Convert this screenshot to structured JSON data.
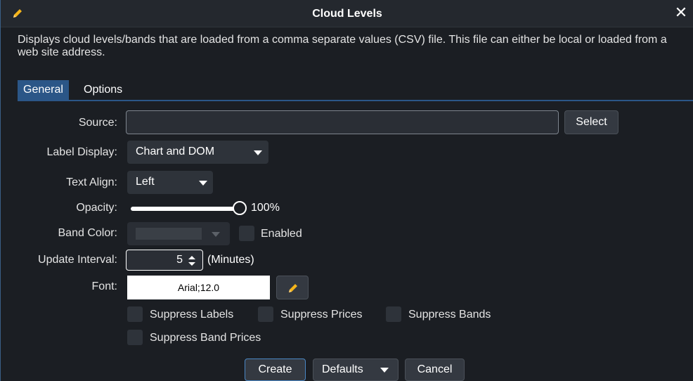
{
  "window": {
    "title": "Cloud Levels",
    "title_icon": "pencil-icon",
    "close_icon": "close-icon",
    "close_glyph": "✕"
  },
  "description": "Displays cloud levels/bands that are loaded from a comma separate values (CSV) file.  This file can either be local or loaded from a web site address.",
  "tabs": [
    {
      "label": "General",
      "active": true
    },
    {
      "label": "Options",
      "active": false
    }
  ],
  "form": {
    "source": {
      "label": "Source:",
      "value": "",
      "button": "Select"
    },
    "label_display": {
      "label": "Label Display:",
      "value": "Chart and DOM"
    },
    "text_align": {
      "label": "Text Align:",
      "value": "Left"
    },
    "opacity": {
      "label": "Opacity:",
      "value_text": "100%",
      "value": 1.0
    },
    "band_color": {
      "label": "Band Color:",
      "enabled_label": "Enabled",
      "enabled": false
    },
    "update_interval": {
      "label": "Update Interval:",
      "value": "5",
      "unit": "(Minutes)"
    },
    "font": {
      "label": "Font:",
      "value": "Arial;12.0",
      "edit_icon": "pencil-icon"
    }
  },
  "checkboxes": [
    {
      "label": "Suppress Labels",
      "checked": false
    },
    {
      "label": "Suppress Prices",
      "checked": false
    },
    {
      "label": "Suppress Bands",
      "checked": false
    },
    {
      "label": "Suppress Band Prices",
      "checked": false
    }
  ],
  "footer": {
    "create": "Create",
    "defaults": "Defaults",
    "cancel": "Cancel"
  },
  "colors": {
    "background": "#1b1e23",
    "accent": "#2b5687",
    "pencil": "#f5b51a"
  }
}
